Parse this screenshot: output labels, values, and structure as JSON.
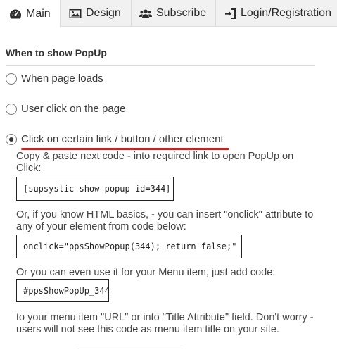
{
  "tabs": [
    {
      "label": "Main",
      "icon": "tachometer-icon",
      "active": true
    },
    {
      "label": "Design",
      "icon": "picture-icon",
      "active": false
    },
    {
      "label": "Subscribe",
      "icon": "users-icon",
      "active": false
    },
    {
      "label": "Login/Registration",
      "icon": "sign-in-icon",
      "active": false
    }
  ],
  "section": {
    "title": "When to show PopUp"
  },
  "options": [
    {
      "label": "When page loads",
      "checked": false
    },
    {
      "label": "User click on the page",
      "checked": false
    },
    {
      "label": "Click on certain link / button / other element",
      "checked": true
    }
  ],
  "details": {
    "intro": "Copy & paste next code - into required link to open PopUp on Click:",
    "shortcode": "[supsystic-show-popup id=344]",
    "onclick_intro": "Or, if you know HTML basics, - you can insert \"onclick\" attribute to any of your element from code below:",
    "onclick_code": "onclick=\"ppsShowPopup(344); return false;\"",
    "menu_intro": "Or you can even use it for your Menu item, just add code:",
    "menu_code": "#ppsShowPopUp_344",
    "menu_outro": "to your menu item \"URL\" or into \"Title Attribute\" field. Don't worry - users will not see this code as menu item title on your site."
  },
  "colors": {
    "accent_underline": "#d11f1f",
    "tab_bar": "#f1f1f1"
  }
}
